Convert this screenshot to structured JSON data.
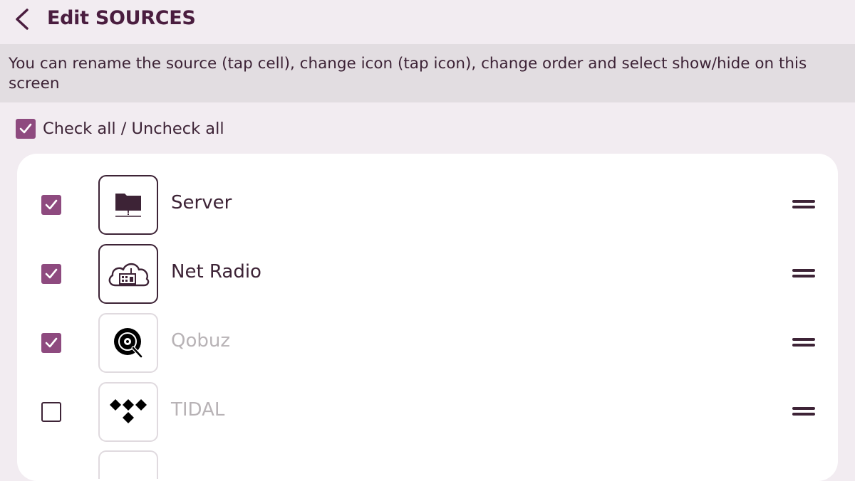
{
  "header": {
    "title": "Edit SOURCES"
  },
  "info": {
    "text": "You can rename the source (tap cell), change icon (tap icon), change order and select show/hide on this screen"
  },
  "check_all": {
    "label": "Check all / Uncheck all",
    "checked": true
  },
  "sources": [
    {
      "label": "Server",
      "checked": true,
      "icon": "server-folder-icon",
      "dimmed": false
    },
    {
      "label": "Net Radio",
      "checked": true,
      "icon": "cloud-radio-icon",
      "dimmed": false
    },
    {
      "label": "Qobuz",
      "checked": true,
      "icon": "qobuz-logo-icon",
      "dimmed": true
    },
    {
      "label": "TIDAL",
      "checked": false,
      "icon": "tidal-logo-icon",
      "dimmed": true
    }
  ],
  "colors": {
    "accent": "#8e4a7f",
    "text": "#3d2336",
    "title": "#4a1d3f",
    "background": "#f2ecf1",
    "info_bar": "#e2dde1",
    "dim_text": "#b8b3b6"
  }
}
